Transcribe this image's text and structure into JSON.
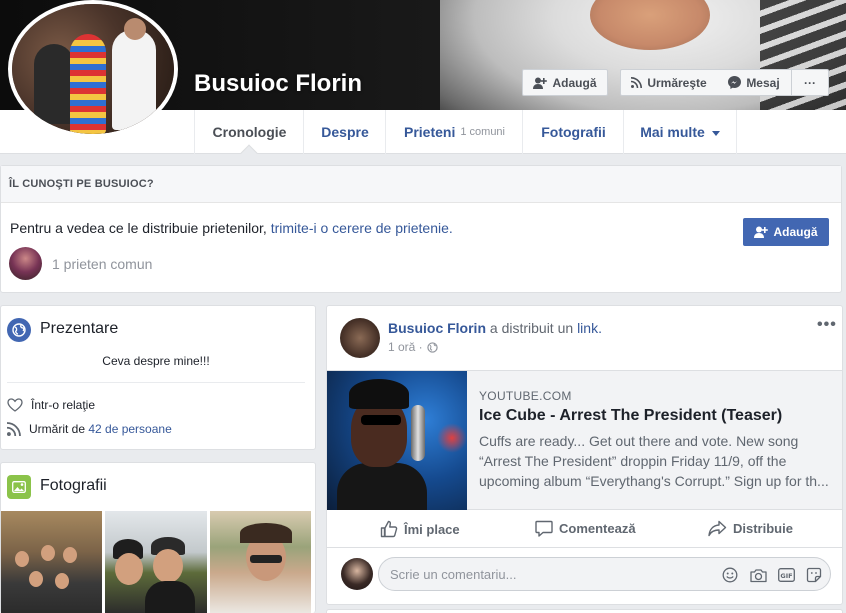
{
  "profile": {
    "name": "Busuioc Florin"
  },
  "cover_buttons": {
    "add": "Adaugă",
    "follow": "Urmăreşte",
    "message": "Mesaj",
    "more": "···"
  },
  "nav": {
    "tabs": [
      {
        "label": "Cronologie"
      },
      {
        "label": "Despre"
      },
      {
        "label": "Prieteni",
        "sub": "1 comuni"
      },
      {
        "label": "Fotografii"
      },
      {
        "label": "Mai multe"
      }
    ]
  },
  "know": {
    "heading": "ÎL CUNOŞTI PE BUSUIOC?",
    "text_prefix": "Pentru a vedea ce le distribuie prietenilor, ",
    "text_link": "trimite-i o cerere de prietenie",
    "text_suffix": ".",
    "button": "Adaugă",
    "mutual": "1 prieten comun"
  },
  "intro": {
    "title": "Prezentare",
    "bio": "Ceva despre mine!!!",
    "relationship": "Într-o relaţie",
    "followed_prefix": "Urmărit de ",
    "followed_link": "42 de persoane"
  },
  "photos": {
    "title": "Fotografii"
  },
  "post": {
    "author": "Busuioc Florin",
    "action": " a distribuit un ",
    "action_link": "link",
    "action_end": ".",
    "time": "1 oră ·",
    "more": "•••",
    "link": {
      "domain": "YOUTUBE.COM",
      "title": "Ice Cube - Arrest The President (Teaser)",
      "description": "Cuffs are ready... Get out there and vote. New song “Arrest The President” droppin Friday 11/9, off the upcoming album “Everythang's Corrupt.” Sign up for th..."
    },
    "actions": {
      "like": "Îmi place",
      "comment": "Comentează",
      "share": "Distribuie"
    },
    "comment_placeholder": "Scrie un comentariu..."
  }
}
